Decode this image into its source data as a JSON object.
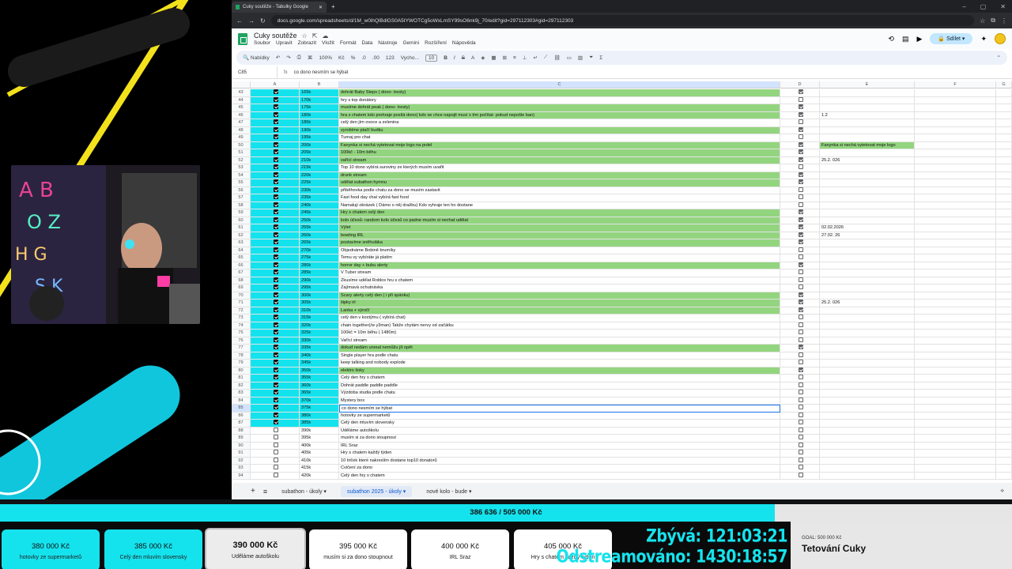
{
  "browser": {
    "tab_title": "Cuky soutěže - Tabulky Google",
    "url": "docs.google.com/spreadsheets/d/1M_w0ihQlBdlGS0A5tYWOTCg5oWxLmSY99sO6nk9j_70/edit?gid=297112303#gid=297112303"
  },
  "doc": {
    "title": "Cuky soutěže",
    "menus": [
      "Soubor",
      "Upravit",
      "Zobrazit",
      "Vložit",
      "Formát",
      "Data",
      "Nástroje",
      "Gemini",
      "Rozšíření",
      "Nápověda"
    ],
    "share_label": "Sdílet"
  },
  "toolbar": {
    "search_label": "Nabídky",
    "zoom": "100%",
    "currency": "Kč",
    "percent": "%",
    "dec1": ".0",
    "dec2": ".00",
    "format123": "123",
    "font": "Vycho...",
    "font_size": "10"
  },
  "formula": {
    "name_box": "C85",
    "fx": "fx",
    "value": "co dono nesmím se hýbat"
  },
  "columns": [
    "A",
    "B",
    "C",
    "D",
    "E",
    "F",
    "G"
  ],
  "rows": [
    {
      "n": "43",
      "b": "165k",
      "c": "dohrát Baby Steps ( dono- tresty)",
      "d": true,
      "e": "",
      "green": true
    },
    {
      "n": "44",
      "b": "170k",
      "c": "hry s top donátory",
      "d": false,
      "e": "",
      "green": false
    },
    {
      "n": "45",
      "b": "175k",
      "c": "musíme dohrát peak ( dono- tresty)",
      "d": true,
      "e": "",
      "green": true
    },
    {
      "n": "46",
      "b": "180k",
      "c": "hra s chatem kdo prohraje posílá dono( kdo se chce napojit musí s tím počítat- pokud nepošle ban)",
      "d": true,
      "e": "1.2",
      "green": true
    },
    {
      "n": "47",
      "b": "185k",
      "c": "celý den jím ovoce a zelenina",
      "d": false,
      "e": "",
      "green": false
    },
    {
      "n": "48",
      "b": "190k",
      "c": "vyrobíme ptačí budku",
      "d": true,
      "e": "",
      "green": true
    },
    {
      "n": "49",
      "b": "195k",
      "c": "Turnaj pro chat",
      "d": false,
      "e": "",
      "green": false
    },
    {
      "n": "50",
      "b": "200k",
      "c": "Fanynka si nechá vytetovat moje logo na prdel",
      "d": true,
      "e": "Fanynka si nechá vytetovat moje logo",
      "green": true
    },
    {
      "n": "51",
      "b": "205k",
      "c": "100kč - 10m běhu",
      "d": true,
      "e": "",
      "green": true
    },
    {
      "n": "52",
      "b": "210k",
      "c": "vařící stream",
      "d": true,
      "e": "25.2. 026",
      "green": true
    },
    {
      "n": "53",
      "b": "215k",
      "c": "Top 10 dono vybírá suroviny ze kterých musím uvařit",
      "d": false,
      "e": "",
      "green": false
    },
    {
      "n": "54",
      "b": "220k",
      "c": "drunk stream",
      "d": true,
      "e": "",
      "green": true
    },
    {
      "n": "55",
      "b": "225k",
      "c": "udělat subathon hymnu",
      "d": true,
      "e": "",
      "green": true
    },
    {
      "n": "56",
      "b": "230k",
      "c": "přiběhovka podle chatu za dono se musím zastavit",
      "d": false,
      "e": "",
      "green": false
    },
    {
      "n": "57",
      "b": "235k",
      "c": "Fast food day chat vybírá fast food",
      "d": false,
      "e": "",
      "green": false
    },
    {
      "n": "58",
      "b": "240k",
      "c": "Namaluji obrázek ( Dámo o něj dražbu) Kdo vyhraje ten ho dostane",
      "d": false,
      "e": "",
      "green": false
    },
    {
      "n": "59",
      "b": "245k",
      "c": "Hry s chatem celý den",
      "d": true,
      "e": "",
      "green": true
    },
    {
      "n": "60",
      "b": "250k",
      "c": "kolo účesů- random kolo účesů co padne musím si nechat udělat",
      "d": true,
      "e": "",
      "green": true
    },
    {
      "n": "61",
      "b": "255k",
      "c": "Výlet",
      "d": true,
      "e": "02.02.2026",
      "green": true
    },
    {
      "n": "62",
      "b": "260k",
      "c": "bowling IRL",
      "d": true,
      "e": "27.02. 26",
      "green": true
    },
    {
      "n": "63",
      "b": "265k",
      "c": "postavíme sněhuláka",
      "d": true,
      "e": "",
      "green": true
    },
    {
      "n": "64",
      "b": "270k",
      "c": "Objednáme Bobině brumíky",
      "d": false,
      "e": "",
      "green": false
    },
    {
      "n": "65",
      "b": "275k",
      "c": "Temu vy vybíráte já platím",
      "d": false,
      "e": "",
      "green": false
    },
    {
      "n": "66",
      "b": "280k",
      "c": "horror day + bubu alerty",
      "d": true,
      "e": "",
      "green": true
    },
    {
      "n": "67",
      "b": "285k",
      "c": "V Tuber stream",
      "d": false,
      "e": "",
      "green": false
    },
    {
      "n": "68",
      "b": "290k",
      "c": "Zkusíme udělat Roblox hru s chatem",
      "d": false,
      "e": "",
      "green": false
    },
    {
      "n": "69",
      "b": "295k",
      "c": "Zajímavá ochutnávka",
      "d": false,
      "e": "",
      "green": false
    },
    {
      "n": "70",
      "b": "300k",
      "c": "Scary alerty celý den ( i při spánku)",
      "d": true,
      "e": "",
      "green": true
    },
    {
      "n": "71",
      "b": "305k",
      "c": "šipky irl",
      "d": true,
      "e": "25.2. 026",
      "green": true
    },
    {
      "n": "72",
      "b": "310k",
      "c": "Lanka + výročí",
      "d": true,
      "e": "",
      "green": true
    },
    {
      "n": "73",
      "b": "315k",
      "c": "celý den v kostýmu ( vybírá chat)",
      "d": false,
      "e": "",
      "green": false
    },
    {
      "n": "74",
      "b": "320k",
      "c": "chain together(/w y3man) Takže chytám nervy od začátku",
      "d": false,
      "e": "",
      "green": false
    },
    {
      "n": "75",
      "b": "325k",
      "c": "100kč = 10m běhu ( 1480m)",
      "d": false,
      "e": "",
      "green": false
    },
    {
      "n": "76",
      "b": "330k",
      "c": "Vařící stream",
      "d": false,
      "e": "",
      "green": false
    },
    {
      "n": "77",
      "b": "335k",
      "c": "dokud nedám unreal nemůžu jít opět",
      "d": true,
      "e": "",
      "green": true
    },
    {
      "n": "78",
      "b": "340k",
      "c": "Single player hra podle chatu",
      "d": false,
      "e": "",
      "green": false
    },
    {
      "n": "79",
      "b": "345k",
      "c": "keep talking and nobody explode",
      "d": false,
      "e": "",
      "green": false
    },
    {
      "n": "80",
      "b": "350k",
      "c": "elektro šoky",
      "d": true,
      "e": "",
      "green": true
    },
    {
      "n": "81",
      "b": "355k",
      "c": "Celý den hry s chatem",
      "d": false,
      "e": "",
      "green": false
    },
    {
      "n": "82",
      "b": "360k",
      "c": "Dohrát paddle paddle paddle",
      "d": false,
      "e": "",
      "green": false
    },
    {
      "n": "83",
      "b": "365k",
      "c": "Výzdoba studia podle chatu",
      "d": false,
      "e": "",
      "green": false
    },
    {
      "n": "84",
      "b": "370k",
      "c": "Mystery box",
      "d": false,
      "e": "",
      "green": false
    },
    {
      "n": "85",
      "b": "375k",
      "c": "co dono nesmím se hýbat",
      "d": false,
      "e": "",
      "green": false
    },
    {
      "n": "86",
      "b": "380k",
      "c": "hotovky ze supermarketů",
      "d": false,
      "e": "",
      "green": false
    },
    {
      "n": "87",
      "b": "385k",
      "c": "Celý den mluvím slovensky",
      "d": false,
      "e": "",
      "green": false
    },
    {
      "n": "88",
      "b": "390k",
      "c": "Uděláme autoškolu",
      "d": false,
      "e": "",
      "green": false,
      "a_off": true
    },
    {
      "n": "89",
      "b": "395k",
      "c": "musím si za dono stoupnout",
      "d": false,
      "e": "",
      "green": false,
      "a_off": true
    },
    {
      "n": "90",
      "b": "400k",
      "c": "IRL Sraz",
      "d": false,
      "e": "",
      "green": false,
      "a_off": true
    },
    {
      "n": "91",
      "b": "405k",
      "c": "Hry s chatem každý týden",
      "d": false,
      "e": "",
      "green": false,
      "a_off": true
    },
    {
      "n": "92",
      "b": "410k",
      "c": "10 triček které nakreslím dostane top10 donatorů",
      "d": false,
      "e": "",
      "green": false,
      "a_off": true
    },
    {
      "n": "93",
      "b": "415k",
      "c": "Cvičení za dono",
      "d": false,
      "e": "",
      "green": false,
      "a_off": true
    },
    {
      "n": "94",
      "b": "420k",
      "c": "Celý den hry s chatem",
      "d": false,
      "e": "",
      "green": false,
      "a_off": true
    }
  ],
  "sheet_tabs": [
    "subathon - úkoly",
    "subathon 2025 - úkoly",
    "nové kolo - bude"
  ],
  "active_sheet_index": 1,
  "progress": {
    "text": "386 636 / 505 000 Kč",
    "fraction": 0.7656,
    "fill_color": "#14e3ee"
  },
  "cards": [
    {
      "amount": "380 000 Kč",
      "label": "hotovky ze supermarketů",
      "style": "cyan"
    },
    {
      "amount": "385 000 Kč",
      "label": "Celý den mluvím slovensky",
      "style": "cyan"
    },
    {
      "amount": "390 000 Kč",
      "label": "Uděláme autoškolu",
      "style": "sel"
    },
    {
      "amount": "395 000 Kč",
      "label": "musím si za dono stoupnout",
      "style": "white"
    },
    {
      "amount": "400 000 Kč",
      "label": "IRL Sraz",
      "style": "white"
    },
    {
      "amount": "405 000 Kč",
      "label": "Hry s chatem každý týden",
      "style": "white"
    }
  ],
  "timers": {
    "remaining": "Zbývá: 121:03:21",
    "streamed": "Odstreamováno: 1430:18:57"
  },
  "goal": {
    "small": "GOAL: 500 000 Kč",
    "name": "Tetování Cuky"
  },
  "colors": {
    "green_row": "#93d57f",
    "cyan_col": "#14e3ee",
    "accent_yellow": "#f3e21b"
  }
}
